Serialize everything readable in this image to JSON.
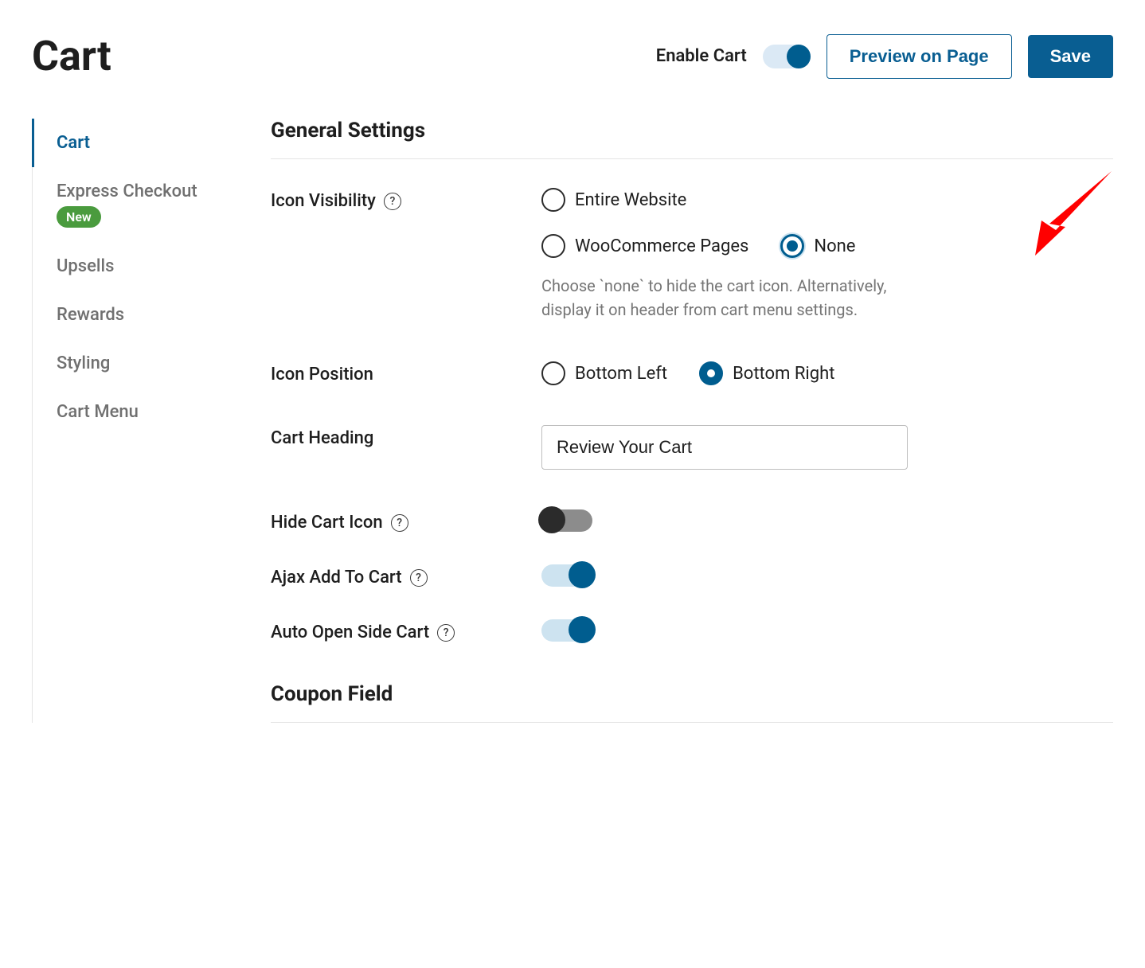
{
  "header": {
    "title": "Cart",
    "enable_label": "Enable Cart",
    "enable_on": true,
    "preview_label": "Preview on Page",
    "save_label": "Save"
  },
  "sidebar": {
    "items": [
      {
        "label": "Cart",
        "active": true
      },
      {
        "label": "Express Checkout",
        "badge": "New"
      },
      {
        "label": "Upsells"
      },
      {
        "label": "Rewards"
      },
      {
        "label": "Styling"
      },
      {
        "label": "Cart Menu"
      }
    ]
  },
  "sections": {
    "general_title": "General Settings",
    "coupon_title": "Coupon Field"
  },
  "settings": {
    "icon_visibility": {
      "label": "Icon Visibility",
      "options": {
        "entire": "Entire Website",
        "woo": "WooCommerce Pages",
        "none": "None"
      },
      "selected": "none",
      "help": "Choose `none` to hide the cart icon. Alternatively, display it on header from cart menu settings."
    },
    "icon_position": {
      "label": "Icon Position",
      "options": {
        "bl": "Bottom Left",
        "br": "Bottom Right"
      },
      "selected": "br"
    },
    "cart_heading": {
      "label": "Cart Heading",
      "value": "Review Your Cart"
    },
    "hide_cart_icon": {
      "label": "Hide Cart Icon",
      "on": false
    },
    "ajax_add": {
      "label": "Ajax Add To Cart",
      "on": true
    },
    "auto_open": {
      "label": "Auto Open Side Cart",
      "on": true
    }
  }
}
